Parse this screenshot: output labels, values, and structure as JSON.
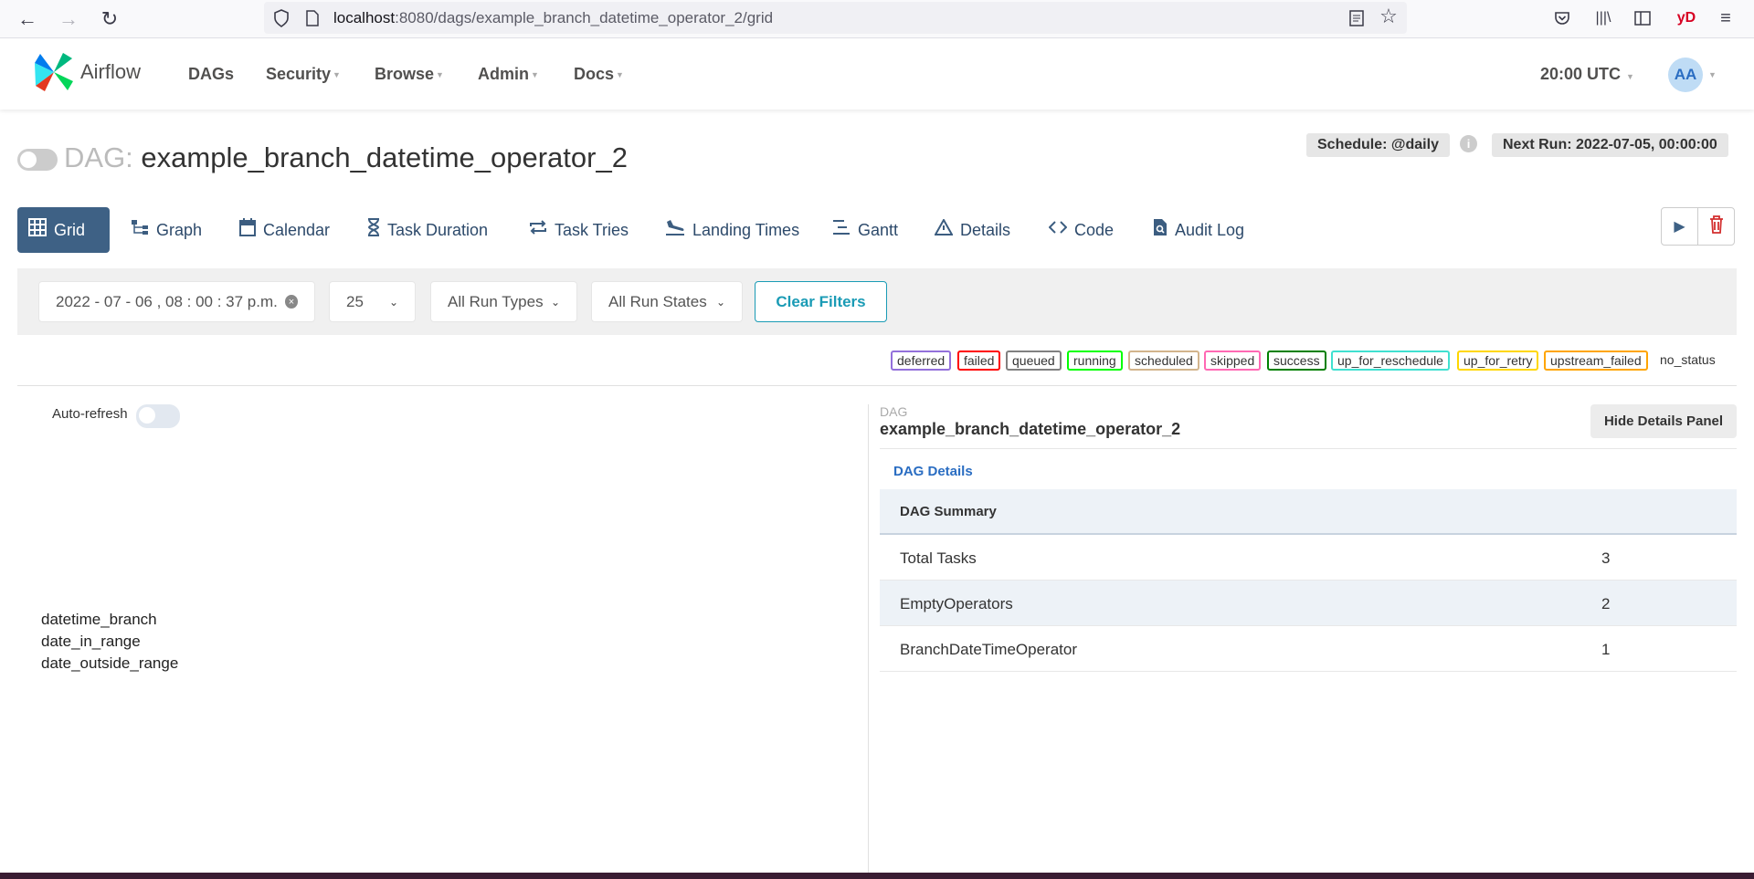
{
  "browser": {
    "url_host": "localhost",
    "url_path": ":8080/dags/example_branch_datetime_operator_2/grid",
    "profile": "yD"
  },
  "navbar": {
    "brand": "Airflow",
    "items": [
      "DAGs",
      "Security",
      "Browse",
      "Admin",
      "Docs"
    ],
    "time": "20:00 UTC",
    "avatar": "AA"
  },
  "dag": {
    "label": "DAG:",
    "name": "example_branch_datetime_operator_2",
    "schedule": "Schedule: @daily",
    "next_run": "Next Run: 2022-07-05, 00:00:00"
  },
  "tabs": [
    "Grid",
    "Graph",
    "Calendar",
    "Task Duration",
    "Task Tries",
    "Landing Times",
    "Gantt",
    "Details",
    "Code",
    "Audit Log"
  ],
  "filters": {
    "date": "2022 - 07 - 06 ,  08 : 00 : 37   p.m.",
    "num_runs": "25",
    "run_types": "All Run Types",
    "run_states": "All Run States",
    "clear": "Clear Filters"
  },
  "legend": [
    {
      "label": "deferred",
      "color": "#9370db"
    },
    {
      "label": "failed",
      "color": "#ff0000"
    },
    {
      "label": "queued",
      "color": "#808080"
    },
    {
      "label": "running",
      "color": "#00ff00"
    },
    {
      "label": "scheduled",
      "color": "#d2b48c"
    },
    {
      "label": "skipped",
      "color": "#ff69b4"
    },
    {
      "label": "success",
      "color": "#008000"
    },
    {
      "label": "up_for_reschedule",
      "color": "#40e0d0"
    },
    {
      "label": "up_for_retry",
      "color": "#ffd700"
    },
    {
      "label": "upstream_failed",
      "color": "#ffa500"
    }
  ],
  "legend_plain": "no_status",
  "grid": {
    "auto_refresh": "Auto-refresh",
    "tasks": [
      "datetime_branch",
      "date_in_range",
      "date_outside_range"
    ]
  },
  "details": {
    "small_label": "DAG",
    "name": "example_branch_datetime_operator_2",
    "hide_button": "Hide Details Panel",
    "section_link": "DAG Details",
    "table_header": "DAG Summary",
    "rows": [
      {
        "key": "Total Tasks",
        "value": "3"
      },
      {
        "key": "EmptyOperators",
        "value": "2"
      },
      {
        "key": "BranchDateTimeOperator",
        "value": "1"
      }
    ]
  }
}
